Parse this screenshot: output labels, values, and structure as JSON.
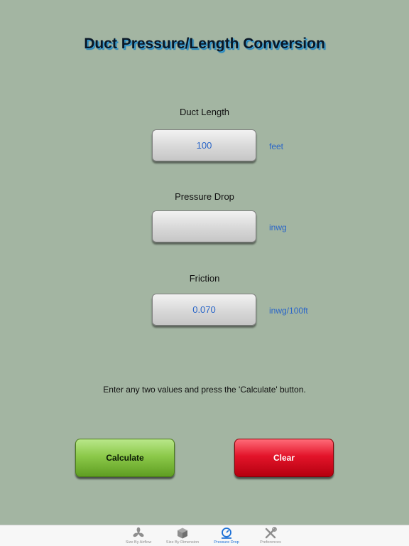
{
  "page": {
    "title": "Duct Pressure/Length Conversion"
  },
  "fields": {
    "duct_length": {
      "label": "Duct Length",
      "value": "100",
      "unit": "feet"
    },
    "pressure_drop": {
      "label": "Pressure Drop",
      "value": "",
      "unit": "inwg"
    },
    "friction": {
      "label": "Friction",
      "value": "0.070",
      "unit": "inwg/100ft"
    }
  },
  "hint": "Enter any two values and press the 'Calculate' button.",
  "buttons": {
    "calculate": "Calculate",
    "clear": "Clear"
  },
  "tabbar": {
    "tabs": [
      {
        "label": "Size By Airflow",
        "icon": "fan-icon",
        "active": false
      },
      {
        "label": "Size By Dimension",
        "icon": "box-icon",
        "active": false
      },
      {
        "label": "Pressure Drop",
        "icon": "pressure-gauge-icon",
        "active": true
      },
      {
        "label": "Preferences",
        "icon": "tools-icon",
        "active": false
      }
    ]
  },
  "colors": {
    "background": "#a3b5a2",
    "value_text": "#2a66c8",
    "calculate_green": "#8cc94a",
    "clear_red": "#e3142a",
    "tab_active": "#1a6fd6",
    "tab_inactive": "#8e8e8e"
  }
}
